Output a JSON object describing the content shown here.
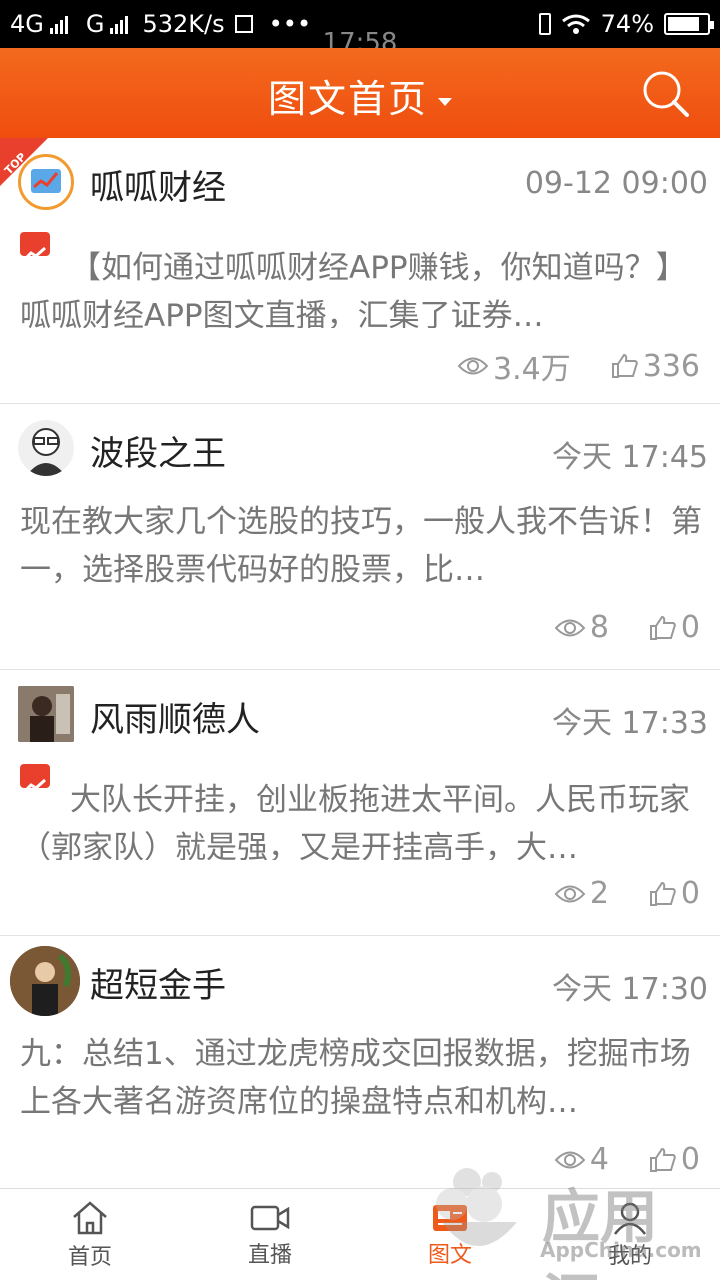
{
  "status_bar": {
    "network_1": "4G",
    "network_2": "G",
    "speed": "532K/s",
    "time": "17:58",
    "battery": "74%",
    "battery_level": 0.74
  },
  "header": {
    "title": "图文首页",
    "dropdown_icon": "caret-down-icon",
    "search_icon": "search-icon"
  },
  "posts": [
    {
      "author": "呱呱财经",
      "time": "09-12 09:00",
      "text": "【如何通过呱呱财经APP赚钱，你知道吗？】呱呱财经APP图文直播，汇集了证券…",
      "views": "3.4万",
      "likes": "336",
      "pinned": true,
      "badge": "TOP"
    },
    {
      "author": "波段之王",
      "time": "今天 17:45",
      "text": "现在教大家几个选股的技巧，一般人我不告诉！第一，选择股票代码好的股票，比…",
      "views": "8",
      "likes": "0"
    },
    {
      "author": "风雨顺德人",
      "time": "今天 17:33",
      "text": "大队长开挂，创业板拖进太平间。人民币玩家（郭家队）就是强，又是开挂高手，大…",
      "views": "2",
      "likes": "0"
    },
    {
      "author": "超短金手",
      "time": "今天 17:30",
      "text": "九：总结1、通过龙虎榜成交回报数据，挖掘市场上各大著名游资席位的操盘特点和机构…",
      "views": "4",
      "likes": "0"
    }
  ],
  "tabs": [
    {
      "label": "首页",
      "icon": "home-icon"
    },
    {
      "label": "直播",
      "icon": "video-icon"
    },
    {
      "label": "图文",
      "icon": "article-icon",
      "active": true
    },
    {
      "label": "我的",
      "icon": "profile-icon"
    }
  ],
  "watermark": {
    "text": "应用汇",
    "sub": "AppChina.com"
  },
  "colors": {
    "brand": "#ef5a1b",
    "tag_red": "#e8402c"
  }
}
